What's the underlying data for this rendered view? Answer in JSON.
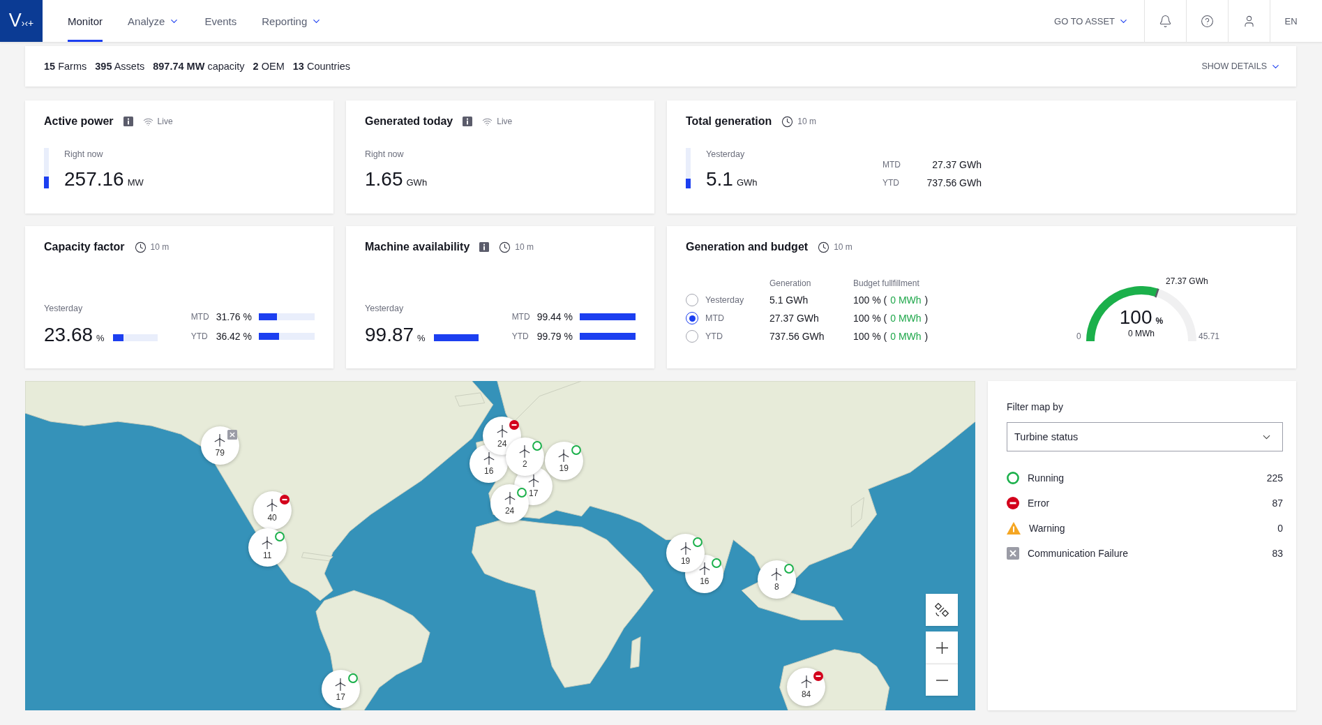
{
  "nav": {
    "logo": {
      "letter": "V",
      "mark": "›‹+"
    },
    "tabs": [
      {
        "label": "Monitor",
        "selected": true,
        "dropdown": false
      },
      {
        "label": "Analyze",
        "selected": false,
        "dropdown": true
      },
      {
        "label": "Events",
        "selected": false,
        "dropdown": false
      },
      {
        "label": "Reporting",
        "selected": false,
        "dropdown": true
      }
    ],
    "go_to_asset": "GO TO ASSET",
    "language": "EN"
  },
  "summary": {
    "items": [
      "**15** Farms",
      "**395** Assets",
      "**897.74 MW** capacity",
      "**2** OEM",
      "**13** Countries"
    ],
    "details": "SHOW DETAILS"
  },
  "card_rows": [
    [
      {
        "kind": "stat",
        "title": "Active power",
        "info": true,
        "freshness": {
          "kind": "live",
          "text": "Live"
        },
        "caption": "Right now",
        "value": "257.16",
        "unit": "MW",
        "level": 0.29
      },
      {
        "kind": "stat",
        "title": "Generated today",
        "info": true,
        "freshness": {
          "kind": "live",
          "text": "Live"
        },
        "caption": "Right now",
        "value": "1.65",
        "unit": "GWh"
      },
      {
        "kind": "stat",
        "title": "Total generation",
        "info": false,
        "freshness": {
          "kind": "clock",
          "text": "10 m"
        },
        "caption": "Yesterday",
        "value": "5.1",
        "unit": "GWh",
        "level": 0.24,
        "periods": [
          {
            "label": "MTD",
            "value": "27.37 GWh"
          },
          {
            "label": "YTD",
            "value": "737.56 GWh"
          }
        ]
      }
    ],
    [
      {
        "kind": "ratio",
        "title": "Capacity factor",
        "info": false,
        "freshness": {
          "kind": "clock",
          "text": "10 m"
        },
        "caption": "Yesterday",
        "value": "23.68",
        "unit": "%",
        "level": 0.24,
        "periods": [
          {
            "label": "MTD",
            "value": "31.76 %",
            "level": 0.32
          },
          {
            "label": "YTD",
            "value": "36.42 %",
            "level": 0.36
          }
        ]
      },
      {
        "kind": "ratio",
        "title": "Machine availability",
        "info": true,
        "freshness": {
          "kind": "clock",
          "text": "10 m"
        },
        "caption": "Yesterday",
        "value": "99.87",
        "unit": "%",
        "level": 0.9987,
        "periods": [
          {
            "label": "MTD",
            "value": "99.44 %",
            "level": 0.9944
          },
          {
            "label": "YTD",
            "value": "99.79 %",
            "level": 0.9979
          }
        ]
      },
      {
        "kind": "budget",
        "title": "Generation and budget",
        "info": false,
        "freshness": {
          "kind": "clock",
          "text": "10 m"
        },
        "columns": [
          "Generation",
          "Budget fullfillment"
        ],
        "rows": [
          {
            "label": "Yesterday",
            "selected": false,
            "generation": "5.1 GWh",
            "fulfillment": [
              {
                "text": "100 % (",
                "highlight": false
              },
              {
                "text": "0 MWh",
                "highlight": true
              },
              {
                "text": ")",
                "highlight": false
              }
            ]
          },
          {
            "label": "MTD",
            "selected": true,
            "generation": "27.37 GWh",
            "fulfillment": [
              {
                "text": "100 % (",
                "highlight": false
              },
              {
                "text": "0 MWh",
                "highlight": true
              },
              {
                "text": ")",
                "highlight": false
              }
            ]
          },
          {
            "label": "YTD",
            "selected": false,
            "generation": "737.56 GWh",
            "fulfillment": [
              {
                "text": "100 % (",
                "highlight": false
              },
              {
                "text": "0 MWh",
                "highlight": true
              },
              {
                "text": ")",
                "highlight": false
              }
            ]
          }
        ],
        "gauge": {
          "level": 0.6,
          "target": "27.37 GWh",
          "value": "100",
          "unit": "%",
          "caption": "0 MWh",
          "min": "0",
          "max": "45.71"
        }
      }
    ]
  ],
  "map": {
    "markers": [
      {
        "count": "79",
        "kind": "comm_failure"
      },
      {
        "count": "40",
        "kind": "error"
      },
      {
        "count": "11",
        "kind": "running"
      },
      {
        "count": "16",
        "kind": "plain"
      },
      {
        "count": "24",
        "kind": "error"
      },
      {
        "count": "17",
        "kind": "plain"
      },
      {
        "count": "2",
        "kind": "running"
      },
      {
        "count": "19",
        "kind": "running"
      },
      {
        "count": "24",
        "kind": "running"
      },
      {
        "count": "16",
        "kind": "running"
      },
      {
        "count": "19",
        "kind": "running"
      },
      {
        "count": "8",
        "kind": "running"
      },
      {
        "count": "17",
        "kind": "running"
      },
      {
        "count": "84",
        "kind": "error"
      }
    ]
  },
  "filter": {
    "label": "Filter map by",
    "select": "Turbine status",
    "legend": [
      {
        "kind": "running",
        "label": "Running",
        "count": "225"
      },
      {
        "kind": "error",
        "label": "Error",
        "count": "87"
      },
      {
        "kind": "warning",
        "label": "Warning",
        "count": "0"
      },
      {
        "kind": "comm_failure",
        "label": "Communication Failure",
        "count": "83"
      }
    ]
  }
}
